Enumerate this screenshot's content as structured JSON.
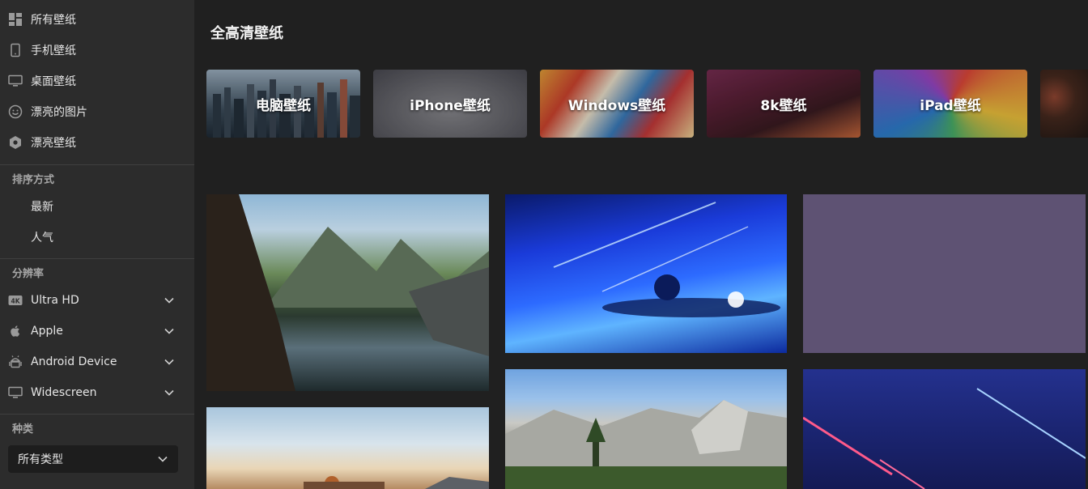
{
  "sidebar": {
    "nav": [
      {
        "label": "所有壁纸",
        "icon": "grid-icon"
      },
      {
        "label": "手机壁纸",
        "icon": "phone-icon"
      },
      {
        "label": "桌面壁纸",
        "icon": "monitor-icon"
      },
      {
        "label": "漂亮的图片",
        "icon": "smiley-icon"
      },
      {
        "label": "漂亮壁纸",
        "icon": "badge-icon"
      }
    ],
    "sort_title": "排序方式",
    "sort": [
      "最新",
      "人气"
    ],
    "resolution_title": "分辨率",
    "resolution": [
      {
        "label": "Ultra HD",
        "icon": "4k-icon"
      },
      {
        "label": "Apple",
        "icon": "apple-icon"
      },
      {
        "label": "Android Device",
        "icon": "android-icon"
      },
      {
        "label": "Widescreen",
        "icon": "monitor-icon"
      }
    ],
    "type_title": "种类",
    "type_select": "所有类型"
  },
  "main": {
    "title": "全高清壁纸",
    "categories": [
      "电脑壁纸",
      "iPhone壁纸",
      "Windows壁纸",
      "8k壁纸",
      "iPad壁纸",
      ""
    ]
  },
  "colors": {
    "background": "#202020",
    "sidebar": "#2c2c2c",
    "purple_tile": "#5e5273"
  }
}
